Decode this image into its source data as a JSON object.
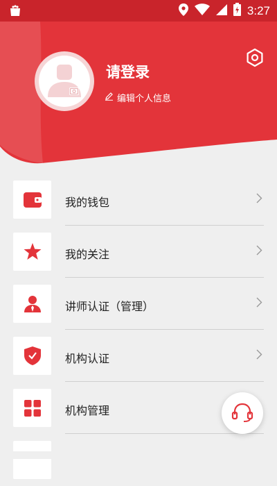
{
  "status_bar": {
    "time": "3:27"
  },
  "profile": {
    "login_label": "请登录",
    "edit_label": "编辑个人信息"
  },
  "colors": {
    "brand_red": "#e3343a",
    "status_red": "#c9242b"
  },
  "menu": {
    "items": [
      {
        "label": "我的钱包",
        "icon": "wallet-icon"
      },
      {
        "label": "我的关注",
        "icon": "star-icon"
      },
      {
        "label": "讲师认证（管理）",
        "icon": "lecturer-icon"
      },
      {
        "label": "机构认证",
        "icon": "shield-check-icon"
      },
      {
        "label": "机构管理",
        "icon": "grid-icon"
      }
    ]
  }
}
